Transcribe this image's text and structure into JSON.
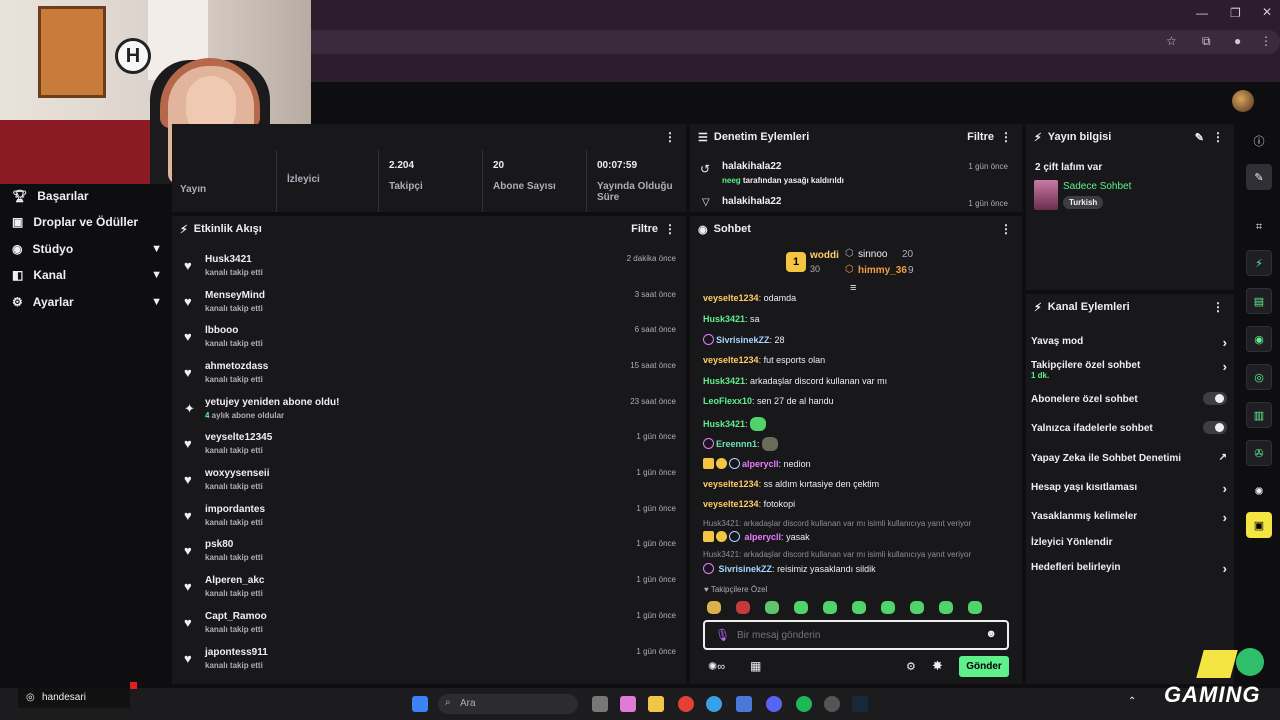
{
  "browser": {
    "tab_area": ""
  },
  "sidebar": {
    "items": [
      {
        "label": "Başarılar",
        "icon": "trophy-icon",
        "expandable": false
      },
      {
        "label": "Droplar ve Ödüller",
        "icon": "gift-icon",
        "expandable": false
      },
      {
        "label": "Stüdyo",
        "icon": "studio-icon",
        "expandable": true
      },
      {
        "label": "Kanal",
        "icon": "channel-icon",
        "expandable": true
      },
      {
        "label": "Ayarlar",
        "icon": "gear-icon",
        "expandable": true
      }
    ]
  },
  "stats": {
    "items": [
      {
        "value": "",
        "label": "Yayın"
      },
      {
        "value": "",
        "label": "İzleyici"
      },
      {
        "value": "2.204",
        "label": "Takipçi"
      },
      {
        "value": "20",
        "label": "Abone Sayısı"
      },
      {
        "value": "00:07:59",
        "label": "Yayında Olduğu Süre"
      }
    ]
  },
  "activity": {
    "title": "Etkinlik Akışı",
    "filter": "Filtre",
    "rows": [
      {
        "name": "Husk3421",
        "sub": "kanalı takip etti",
        "time": "2 dakika önce",
        "type": "follow"
      },
      {
        "name": "MenseyMind",
        "sub": "kanalı takip etti",
        "time": "3 saat önce",
        "type": "follow"
      },
      {
        "name": "lbbooo",
        "sub": "kanalı takip etti",
        "time": "6 saat önce",
        "type": "follow"
      },
      {
        "name": "ahmetozdass",
        "sub": "kanalı takip etti",
        "time": "15 saat önce",
        "type": "follow"
      },
      {
        "name": "yetujey yeniden abone oldu!",
        "sub_highlight": "4",
        "sub": " aylık abone oldular",
        "time": "23 saat önce",
        "type": "sub"
      },
      {
        "name": "veyselte12345",
        "sub": "kanalı takip etti",
        "time": "1 gün önce",
        "type": "follow"
      },
      {
        "name": "woxyysenseii",
        "sub": "kanalı takip etti",
        "time": "1 gün önce",
        "type": "follow"
      },
      {
        "name": "impordantes",
        "sub": "kanalı takip etti",
        "time": "1 gün önce",
        "type": "follow"
      },
      {
        "name": "psk80",
        "sub": "kanalı takip etti",
        "time": "1 gün önce",
        "type": "follow"
      },
      {
        "name": "Alperen_akc",
        "sub": "kanalı takip etti",
        "time": "1 gün önce",
        "type": "follow"
      },
      {
        "name": "Capt_Ramoo",
        "sub": "kanalı takip etti",
        "time": "1 gün önce",
        "type": "follow"
      },
      {
        "name": "japontess911",
        "sub": "kanalı takip etti",
        "time": "1 gün önce",
        "type": "follow"
      }
    ]
  },
  "mod_log": {
    "title": "Denetim Eylemleri",
    "filter": "Filtre",
    "rows": [
      {
        "user": "halakihala22",
        "actor": "neeg",
        "action": " tarafından yasağı kaldırıldı",
        "time": "1 gün önce"
      },
      {
        "user": "halakihala22",
        "time": "1 gün önce"
      }
    ]
  },
  "chat": {
    "title": "Sohbet",
    "leaderboard": [
      {
        "rank": "1",
        "name": "woddi",
        "count": "30"
      },
      {
        "name": "sinnoo",
        "count": "20"
      },
      {
        "name": "himmy_36",
        "count": "9"
      }
    ],
    "messages": [
      {
        "user": "veyselte1234",
        "color": "orange",
        "text": "odamda"
      },
      {
        "user": "Husk3421",
        "color": "green",
        "text": "sa"
      },
      {
        "user": "SivrisinekZZ",
        "color": "blue",
        "text": "28"
      },
      {
        "user": "veyselte1234",
        "color": "orange",
        "text": "fut esports olan"
      },
      {
        "user": "Husk3421",
        "color": "green",
        "text": "arkadaşlar discord kullanan var mı"
      },
      {
        "user": "LeoFlexx10",
        "color": "green",
        "text": "sen 27 de al handu"
      },
      {
        "user": "Husk3421",
        "color": "green",
        "text": ""
      },
      {
        "user": "Ereennn1",
        "color": "teal",
        "text": ""
      },
      {
        "user": "alperycll",
        "color": "purple",
        "text": "nedion"
      },
      {
        "user": "veyselte1234",
        "color": "orange",
        "text": "ss aldım kırtasiye den çektim"
      },
      {
        "user": "veyselte1234",
        "color": "orange",
        "text": "fotokopi"
      }
    ],
    "reply1": "Husk3421: arkadaşlar discord kullanan var mı isimli kullanıcıya yanıt veriyor",
    "reply1_user": "alperycll",
    "reply1_text": "yasak",
    "reply2": "Husk3421: arkadaşlar discord kullanan var mı isimli kullanıcıya yanıt veriyor",
    "reply2_user": "SivrisinekZZ",
    "reply2_text": "reisimiz yasaklandı sildik",
    "emote_label": "Takipçilere Özel",
    "input_placeholder": "Bir mesaj gönderin",
    "send_label": "Gönder"
  },
  "stream_info": {
    "title": "Yayın bilgisi",
    "stream_title": "2 çift lafım var",
    "category": "Sadece Sohbet",
    "tag": "Turkish"
  },
  "channel_actions": {
    "title": "Kanal Eylemleri",
    "rows": [
      {
        "label": "Yavaş mod",
        "control": "chevron"
      },
      {
        "label": "Takipçilere özel sohbet",
        "sub": "1 dk.",
        "control": "chevron"
      },
      {
        "label": "Abonelere özel sohbet",
        "control": "toggle"
      },
      {
        "label": "Yalnızca ifadelerle sohbet",
        "control": "toggle"
      },
      {
        "label": "Yapay Zeka ile Sohbet Denetimi",
        "control": "external"
      },
      {
        "label": "Hesap yaşı kısıtlaması",
        "control": "chevron"
      },
      {
        "label": "Yasaklanmış kelimeler",
        "control": "chevron"
      },
      {
        "label": "İzleyici Yönlendir",
        "control": "none"
      },
      {
        "label": "Hedefleri belirleyin",
        "control": "chevron"
      }
    ]
  },
  "overlay": {
    "user": "handesari",
    "brand": "GAMING"
  },
  "taskbar": {
    "search": "Ara"
  },
  "colors": {
    "accent": "#5ef08b",
    "panel": "#18181b",
    "bg": "#0e0e10",
    "chrome": "#2b1c2e"
  }
}
